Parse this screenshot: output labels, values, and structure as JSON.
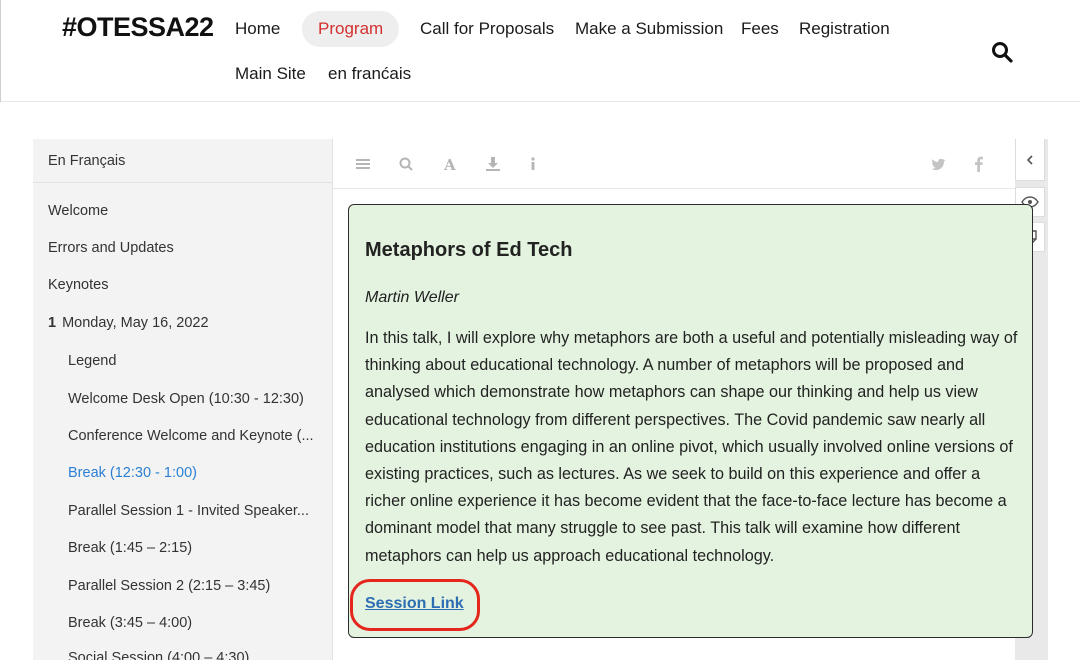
{
  "header": {
    "logo": "#OTESSA22",
    "nav": [
      {
        "label": "Home"
      },
      {
        "label": "Program",
        "active": true
      },
      {
        "label": "Call for Proposals"
      },
      {
        "label": "Make a Submission"
      },
      {
        "label": "Fees"
      },
      {
        "label": "Registration"
      },
      {
        "label": "Main Site"
      },
      {
        "label": "en franćais"
      }
    ],
    "search_icon": "search-icon",
    "active_color": "#d32f2f"
  },
  "sidebar": {
    "top_link": "En Français",
    "items": [
      {
        "label": "Welcome"
      },
      {
        "label": "Errors and Updates"
      },
      {
        "label": "Keynotes"
      },
      {
        "number": "1",
        "label": "Monday, May 16, 2022"
      },
      {
        "label": "Legend"
      },
      {
        "label": "Welcome Desk Open (10:30 - 12:30)"
      },
      {
        "label": "Conference Welcome and Keynote (..."
      },
      {
        "label": "Break (12:30 - 1:00)",
        "current": true
      },
      {
        "label": "Parallel Session 1 - Invited Speaker..."
      },
      {
        "label": "Break (1:45 – 2:15)"
      },
      {
        "label": "Parallel Session 2 (2:15 – 3:45)"
      },
      {
        "label": "Break (3:45 – 4:00)"
      },
      {
        "label": "Social Session (4:00 – 4:30)"
      }
    ],
    "current_color": "#2c80d3"
  },
  "toolbar": {
    "left_icons": [
      "toc-icon",
      "search-icon",
      "font-icon",
      "download-icon",
      "info-icon"
    ],
    "right_icons": [
      "twitter-icon",
      "facebook-icon"
    ]
  },
  "side_panel": {
    "icons": [
      "chevron-left-icon",
      "eye-icon",
      "note-icon"
    ]
  },
  "card": {
    "title": "Metaphors of Ed Tech",
    "author": "Martin Weller",
    "body": "In this talk, I will explore why metaphors are both a useful and potentially misleading way of thinking about educational technology. A number of metaphors will be proposed and analysed which demonstrate how metaphors can shape our thinking and help us view educational technology from different perspectives. The Covid pandemic saw nearly all education institutions engaging in an online pivot, which usually involved online versions of existing practices, such as lectures. As we seek to build on this experience and offer a richer online experience it has become evident that the face-to-face lecture has become a dominant model that many struggle to see past. This talk will examine how different metaphors can help us approach educational technology.",
    "link": "Session Link",
    "background": "#e3f3df",
    "link_color": "#2d6db2",
    "highlight_color": "#e5261c"
  }
}
